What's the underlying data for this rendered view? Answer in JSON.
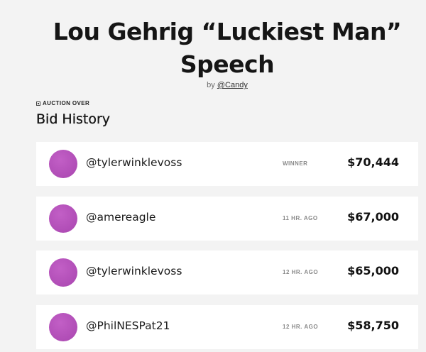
{
  "artwork": {
    "title": "Lou Gehrig “Luckiest Man” Speech",
    "by_prefix": "by",
    "creator": "@Candy"
  },
  "auction": {
    "status": "AUCTION OVER",
    "status_icon": "square-dot-icon"
  },
  "bid_history": {
    "heading": "Bid History",
    "bids": [
      {
        "bidder": "@tylerwinklevoss",
        "time": "WINNER",
        "amount": "$70,444",
        "avatar_color": "#b553b9"
      },
      {
        "bidder": "@amereagle",
        "time": "11 HR. AGO",
        "amount": "$67,000",
        "avatar_color": "#b553b9"
      },
      {
        "bidder": "@tylerwinklevoss",
        "time": "12 HR. AGO",
        "amount": "$65,000",
        "avatar_color": "#b553b9"
      },
      {
        "bidder": "@PhilNESPat21",
        "time": "12 HR. AGO",
        "amount": "$58,750",
        "avatar_color": "#b553b9"
      }
    ]
  }
}
